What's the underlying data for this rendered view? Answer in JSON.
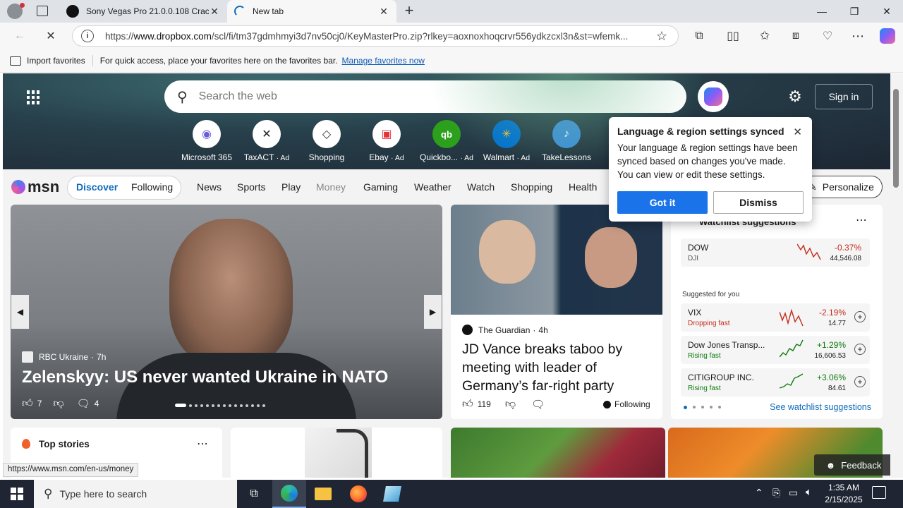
{
  "tabs": [
    {
      "title": "Sony Vegas Pro 21.0.0.108 Crack",
      "active": false
    },
    {
      "title": "New tab",
      "active": true
    }
  ],
  "address": {
    "prefix": "https://",
    "host": "www.dropbox.com",
    "path": "/scl/fi/tm37gdmhmyi3d7nv50cj0/KeyMasterPro.zip?rlkey=aoxnoxhoqcrvr556ydkzcxl3n&st=wfemk..."
  },
  "favbar": {
    "import_label": "Import favorites",
    "hint": "For quick access, place your favorites here on the favorites bar.",
    "manage_link": "Manage favorites now"
  },
  "search": {
    "placeholder": "Search the web"
  },
  "signin_label": "Sign in",
  "quicklinks": [
    {
      "label": "Microsoft 365",
      "ad": ""
    },
    {
      "label": "TaxACT",
      "ad": "· Ad"
    },
    {
      "label": "Shopping",
      "ad": ""
    },
    {
      "label": "Ebay",
      "ad": "· Ad"
    },
    {
      "label": "Quickbo...",
      "ad": "· Ad"
    },
    {
      "label": "Walmart",
      "ad": "· Ad"
    },
    {
      "label": "TakeLessons",
      "ad": ""
    }
  ],
  "msn": {
    "logo": "msn",
    "nav": [
      "Discover",
      "Following",
      "News",
      "Sports",
      "Play",
      "Money",
      "Gaming",
      "Weather",
      "Watch",
      "Shopping",
      "Health"
    ],
    "personalize": "Personalize"
  },
  "popup": {
    "title": "Language & region settings synced",
    "body": "Your language & region settings have been synced based on changes you've made. You can view or edit these settings.",
    "primary": "Got it",
    "secondary": "Dismiss"
  },
  "hero_story": {
    "source": "RBC Ukraine",
    "age": "7h",
    "headline": "Zelenskyy: US never wanted Ukraine in NATO",
    "likes": "7",
    "comments": "4",
    "slides": 15
  },
  "story2": {
    "source": "The Guardian",
    "age": "4h",
    "headline": "JD Vance breaks taboo by meeting with leader of Germany’s far-right party",
    "likes": "119",
    "following": "Following"
  },
  "watchlist": {
    "title": "Watchlist suggestions",
    "suggested_label": "Suggested for you",
    "see_more": "See watchlist suggestions",
    "items": [
      {
        "name": "DOW",
        "sub": "DJI",
        "change": "-0.37%",
        "price": "44,546.08",
        "trend": "",
        "color": "#c42b1c"
      },
      {
        "name": "VIX",
        "sub": "Dropping fast",
        "change": "-2.19%",
        "price": "14.77",
        "trend": "down",
        "color": "#c42b1c"
      },
      {
        "name": "Dow Jones Transp...",
        "sub": "Rising fast",
        "change": "+1.29%",
        "price": "16,606.53",
        "trend": "up",
        "color": "#0f7b0f"
      },
      {
        "name": "CITIGROUP INC.",
        "sub": "Rising fast",
        "change": "+3.06%",
        "price": "84.61",
        "trend": "up",
        "color": "#0f7b0f"
      }
    ]
  },
  "top_stories": {
    "title": "Top stories"
  },
  "feedback": "Feedback",
  "status_url": "https://www.msn.com/en-us/money",
  "taskbar": {
    "search_placeholder": "Type here to search",
    "time": "1:35 AM",
    "date": "2/15/2025"
  },
  "colors": {
    "accent": "#0f6cbd",
    "button_primary": "#0f6cbd",
    "down": "#c42b1c",
    "up": "#0f7b0f"
  }
}
